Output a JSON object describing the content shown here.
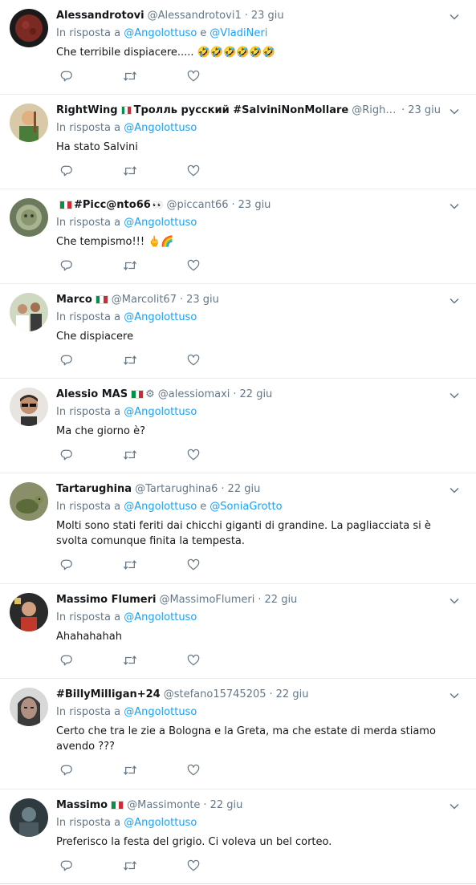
{
  "tweets": [
    {
      "name": "Alessandrotovi",
      "handle": "@Alessandrotovi1",
      "time": "23 giu",
      "reply_prefix": "In risposta a",
      "mentions": [
        "@Angolottuso",
        "@VladiNeri"
      ],
      "joiner": "e",
      "text": "Che terribile dispiacere..... 🤣🤣🤣🤣🤣🤣",
      "flag": false,
      "avatar": {
        "bg": "#1a1a1a",
        "fg": "#7a2a22",
        "icon": "moon-avatar"
      }
    },
    {
      "name": "RightWing",
      "name_extra": "Тролль русский #SalviniNonMollare",
      "handle": "@Rightwi...",
      "time": "23 giu",
      "reply_prefix": "In risposta a",
      "mentions": [
        "@Angolottuso"
      ],
      "text": "Ha stato Salvini",
      "flag": true,
      "avatar": {
        "bg": "#d9c9a8",
        "fg": "#4a7d3a",
        "icon": "cartoon-avatar"
      }
    },
    {
      "name": "#Picc@nto66",
      "handle": "@piccant66",
      "time": "23 giu",
      "reply_prefix": "In risposta a",
      "mentions": [
        "@Angolottuso"
      ],
      "text": "Che tempismo!!! 🖕🌈",
      "flag_before": true,
      "eyes": "👀",
      "avatar": {
        "bg": "#6b7a5c",
        "fg": "#a8b490",
        "icon": "lion-avatar"
      }
    },
    {
      "name": "Marco",
      "handle": "@Marcolit67",
      "time": "23 giu",
      "reply_prefix": "In risposta a",
      "mentions": [
        "@Angolottuso"
      ],
      "text": "Che dispiacere",
      "flag": true,
      "avatar": {
        "bg": "#cfd8c0",
        "fg": "#3a3a3a",
        "icon": "people-avatar"
      }
    },
    {
      "name": "Alessio MAS",
      "handle": "@alessiomaxi",
      "time": "22 giu",
      "reply_prefix": "In risposta a",
      "mentions": [
        "@Angolottuso"
      ],
      "text": "Ma che giorno è?",
      "flag": true,
      "gear": "⚙",
      "avatar": {
        "bg": "#e8e4e0",
        "fg": "#3a2a20",
        "icon": "man-sunglasses-avatar"
      }
    },
    {
      "name": "Tartarughina",
      "handle": "@Tartarughina6",
      "time": "22 giu",
      "reply_prefix": "In risposta a",
      "mentions": [
        "@Angolottuso",
        "@SoniaGrotto"
      ],
      "joiner": "e",
      "text": "Molti sono stati feriti dai chicchi giganti di grandine. La pagliacciata si è svolta comunque finita la tempesta.",
      "flag": false,
      "avatar": {
        "bg": "#8a8f6a",
        "fg": "#5b6b3a",
        "icon": "turtle-avatar"
      }
    },
    {
      "name": "Massimo Flumeri",
      "handle": "@MassimoFlumeri",
      "time": "22 giu",
      "reply_prefix": "In risposta a",
      "mentions": [
        "@Angolottuso"
      ],
      "text": "Ahahahahah",
      "flag": false,
      "avatar": {
        "bg": "#2a2a2a",
        "fg": "#c0392b",
        "icon": "portrait-avatar"
      }
    },
    {
      "name": "#BillyMilligan+24",
      "handle": "@stefano15745205",
      "time": "22 giu",
      "reply_prefix": "In risposta a",
      "mentions": [
        "@Angolottuso"
      ],
      "text": "Certo che tra le zie a Bologna e la Greta, ma che estate di merda stiamo avendo ???",
      "flag": false,
      "avatar": {
        "bg": "#d8d8d8",
        "fg": "#222222",
        "icon": "face-avatar"
      }
    },
    {
      "name": "Massimo",
      "handle": "@Massimonte",
      "time": "22 giu",
      "reply_prefix": "In risposta a",
      "mentions": [
        "@Angolottuso"
      ],
      "text": "Preferisco la festa del grigio. Ci voleva un bel corteo.",
      "flag": true,
      "avatar": {
        "bg": "#2e3a3e",
        "fg": "#6a7f86",
        "icon": "dark-figure-avatar"
      }
    }
  ],
  "colors": {
    "link": "#1da1f2",
    "muted": "#657786",
    "text": "#14171a",
    "border": "#e6ecf0"
  },
  "icons": {
    "reply": "reply-icon",
    "retweet": "retweet-icon",
    "like": "heart-icon",
    "menu": "chevron-down-icon"
  }
}
